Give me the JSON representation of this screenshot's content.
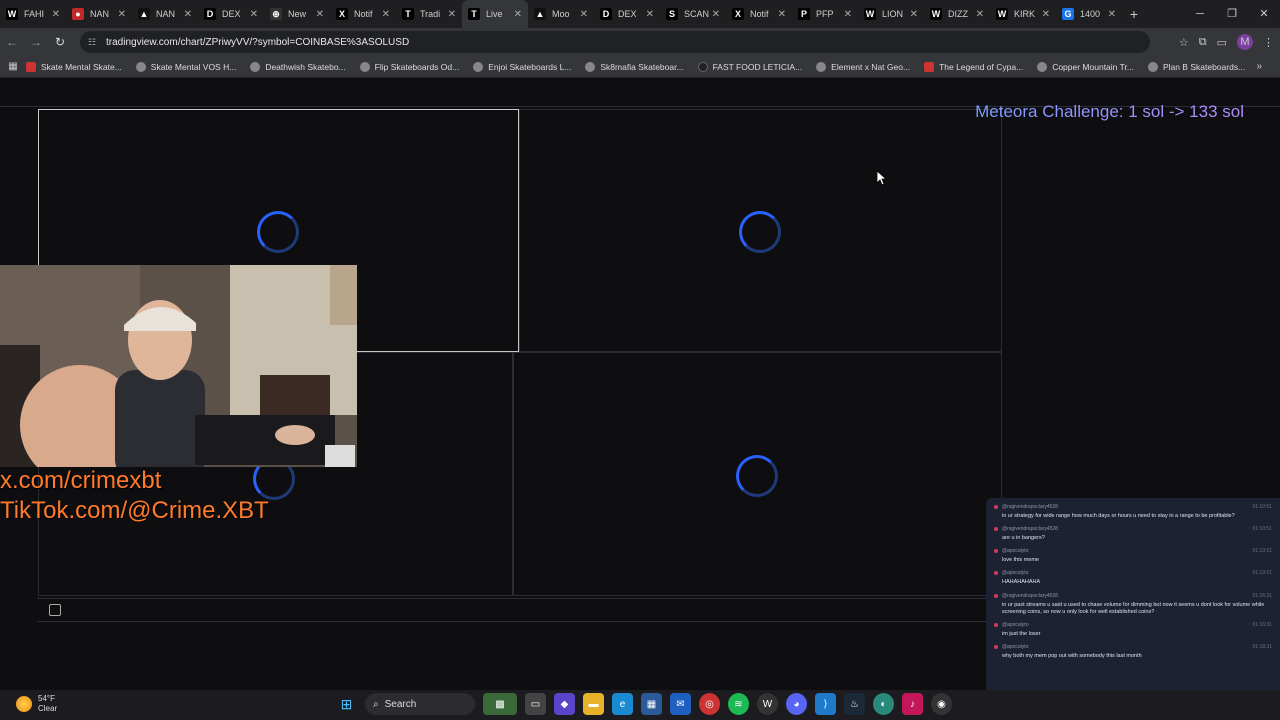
{
  "browser": {
    "tabs": [
      {
        "label": "FAHI",
        "color": "#000000",
        "glyph": "W"
      },
      {
        "label": "NAN",
        "color": "#c22a2a",
        "glyph": "●"
      },
      {
        "label": "NAN",
        "color": "#111111",
        "glyph": "▲"
      },
      {
        "label": "DEX",
        "color": "#000000",
        "glyph": "D"
      },
      {
        "label": "New",
        "color": "#333333",
        "glyph": "⊕"
      },
      {
        "label": "Notif",
        "color": "#000000",
        "glyph": "X"
      },
      {
        "label": "Tradi",
        "color": "#000000",
        "glyph": "T"
      },
      {
        "label": "Live",
        "color": "#000000",
        "glyph": "T",
        "active": true
      },
      {
        "label": "Moo",
        "color": "#111111",
        "glyph": "▲"
      },
      {
        "label": "DEX",
        "color": "#000000",
        "glyph": "D"
      },
      {
        "label": "SCAN",
        "color": "#000000",
        "glyph": "S"
      },
      {
        "label": "Notif",
        "color": "#000000",
        "glyph": "X"
      },
      {
        "label": "PFP",
        "color": "#000000",
        "glyph": "P"
      },
      {
        "label": "LION",
        "color": "#000000",
        "glyph": "W"
      },
      {
        "label": "DIZZ",
        "color": "#000000",
        "glyph": "W"
      },
      {
        "label": "KIRK",
        "color": "#000000",
        "glyph": "W"
      },
      {
        "label": "1400",
        "color": "#1a73e8",
        "glyph": "G"
      }
    ],
    "url": "tradingview.com/chart/ZPriwyVV/?symbol=COINBASE%3ASOLUSD",
    "profile_initial": "M",
    "bookmarks": [
      {
        "label": "Skate Mental Skate...",
        "kind": "sq"
      },
      {
        "label": "Skate Mental VOS H...",
        "kind": "globe"
      },
      {
        "label": "Deathwish Skatebo...",
        "kind": "globe"
      },
      {
        "label": "Flip Skateboards Od...",
        "kind": "globe"
      },
      {
        "label": "Enjoi Skateboards L...",
        "kind": "globe"
      },
      {
        "label": "Sk8mafia Skateboar...",
        "kind": "globe"
      },
      {
        "label": "FAST FOOD LETICIA...",
        "kind": "dk"
      },
      {
        "label": "Element x Nat Geo...",
        "kind": "globe"
      },
      {
        "label": "The Legend of Cypa...",
        "kind": "sq"
      },
      {
        "label": "Copper Mountain Tr...",
        "kind": "globe"
      },
      {
        "label": "Plan B Skateboards...",
        "kind": "globe"
      }
    ]
  },
  "overlay": {
    "banner": "Meteora Challenge: 1 sol -> 133 sol",
    "social_x": "x.com/crimexbt",
    "social_tiktok": "TikTok.com/@Crime.XBT"
  },
  "chat": {
    "messages": [
      {
        "user": "@ragivendrapoclary4528",
        "time": "01:10:51",
        "text": "in ur strategy for wide range how much days or hours u need to stay in a range to be profitable?"
      },
      {
        "user": "@ragivendrapoclary4528",
        "time": "01:10:51",
        "text": "are u in bangers?"
      },
      {
        "user": "@apocalyto",
        "time": "01:13:51",
        "text": "love this meme"
      },
      {
        "user": "@apocalyto",
        "time": "01:13:51",
        "text": "HAHAHAHAHA"
      },
      {
        "user": "@ragivendrapoclary4528",
        "time": "01:16:31",
        "text": "in ur past streams u said u used to chase volume for dimming but now it seems u dont look for volume while screening coins, so now u only look for well established coins?"
      },
      {
        "user": "@apocalyto",
        "time": "01:16:31",
        "text": "im just the loser"
      },
      {
        "user": "@apocalyto",
        "time": "01:18:31",
        "text": "why both my mem pop out with somebody this last month"
      }
    ]
  },
  "taskbar": {
    "temp": "54°F",
    "condition": "Clear",
    "search_label": "Search"
  }
}
